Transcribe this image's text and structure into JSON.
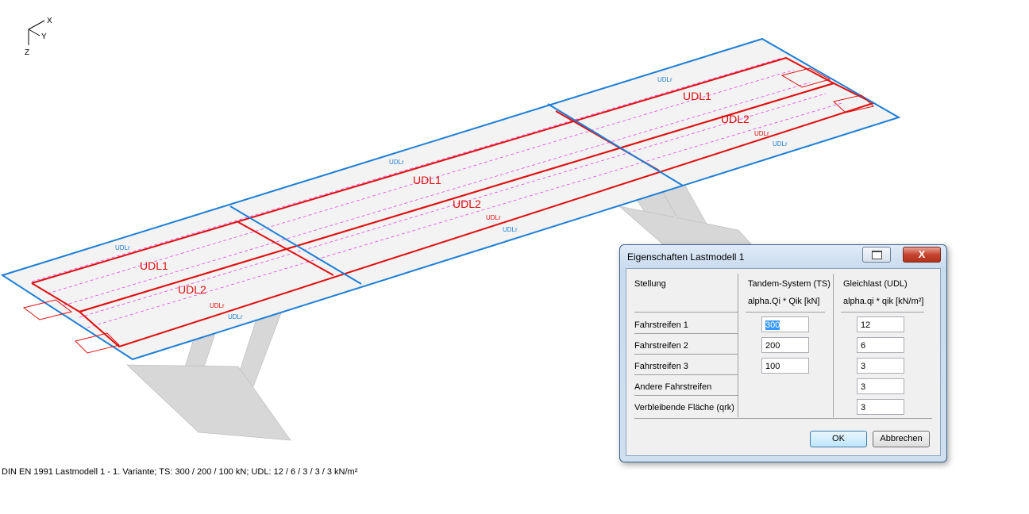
{
  "axes": {
    "x": "X",
    "y": "Y",
    "z": "Z"
  },
  "model": {
    "udl_labels": [
      "UDL1",
      "UDL2",
      "UDL1",
      "UDL2",
      "UDL1",
      "UDL2"
    ],
    "udlr_label": "UDLr",
    "colors": {
      "lane_red": "#e01010",
      "remaining_blue": "#1e7fd6",
      "ts_magenta": "#e01ee0",
      "mesh_gray": "#b8b8b8"
    }
  },
  "status_line": "DIN EN 1991 Lastmodell 1 - 1. Variante; TS: 300 / 200 / 100 kN; UDL: 12 / 6 / 3 / 3 / 3 kN/m²",
  "dialog": {
    "title": "Eigenschaften Lastmodell 1",
    "close_symbol": "X",
    "header": {
      "col1": "Stellung",
      "col2_line1": "Tandem-System (TS)",
      "col2_line2": "alpha.Qi * Qik [kN]",
      "col3_line1": "Gleichlast (UDL)",
      "col3_line2": "alpha.qi * qik [kN/m²]"
    },
    "rows": [
      {
        "label": "Fahrstreifen 1",
        "ts": "300",
        "udl": "12"
      },
      {
        "label": "Fahrstreifen 2",
        "ts": "200",
        "udl": "6"
      },
      {
        "label": "Fahrstreifen 3",
        "ts": "100",
        "udl": "3"
      },
      {
        "label": "Andere Fahrstreifen",
        "udl": "3"
      },
      {
        "label": "Verbleibende Fläche (qrk)",
        "udl": "3"
      }
    ],
    "ok_label": "OK",
    "cancel_label": "Abbrechen"
  }
}
